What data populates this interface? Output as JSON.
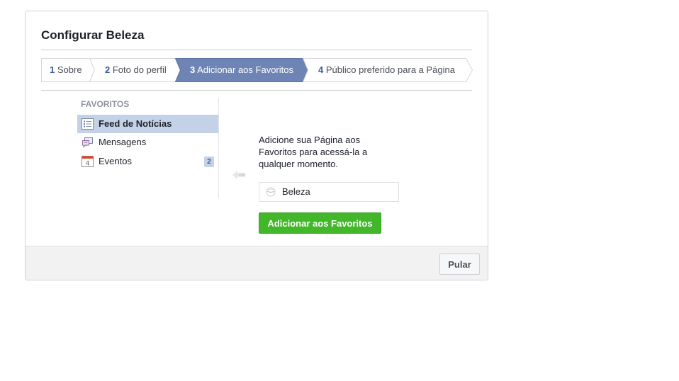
{
  "dialog": {
    "title": "Configurar Beleza"
  },
  "steps": [
    {
      "num": "1",
      "label": "Sobre",
      "active": false
    },
    {
      "num": "2",
      "label": "Foto do perfil",
      "active": false
    },
    {
      "num": "3",
      "label": "Adicionar aos Favoritos",
      "active": true
    },
    {
      "num": "4",
      "label": "Público preferido para a Página",
      "active": false
    }
  ],
  "favorites": {
    "heading": "FAVORITOS",
    "items": [
      {
        "label": "Feed de Notícias",
        "icon": "news-feed-icon",
        "selected": true
      },
      {
        "label": "Mensagens",
        "icon": "messages-icon",
        "selected": false
      },
      {
        "label": "Eventos",
        "icon": "calendar-icon",
        "selected": false,
        "badge": "2",
        "icon_text": "4"
      }
    ]
  },
  "main": {
    "description": "Adicione sua Página aos Favoritos para acessá-la a qualquer momento.",
    "page_name": "Beleza",
    "add_button": "Adicionar aos Favoritos"
  },
  "footer": {
    "skip_button": "Pular"
  },
  "colors": {
    "active_step": "#6d84b4",
    "step_border": "#d3d6db",
    "primary_green": "#42b72a",
    "selected_item": "#c4d2e7"
  }
}
